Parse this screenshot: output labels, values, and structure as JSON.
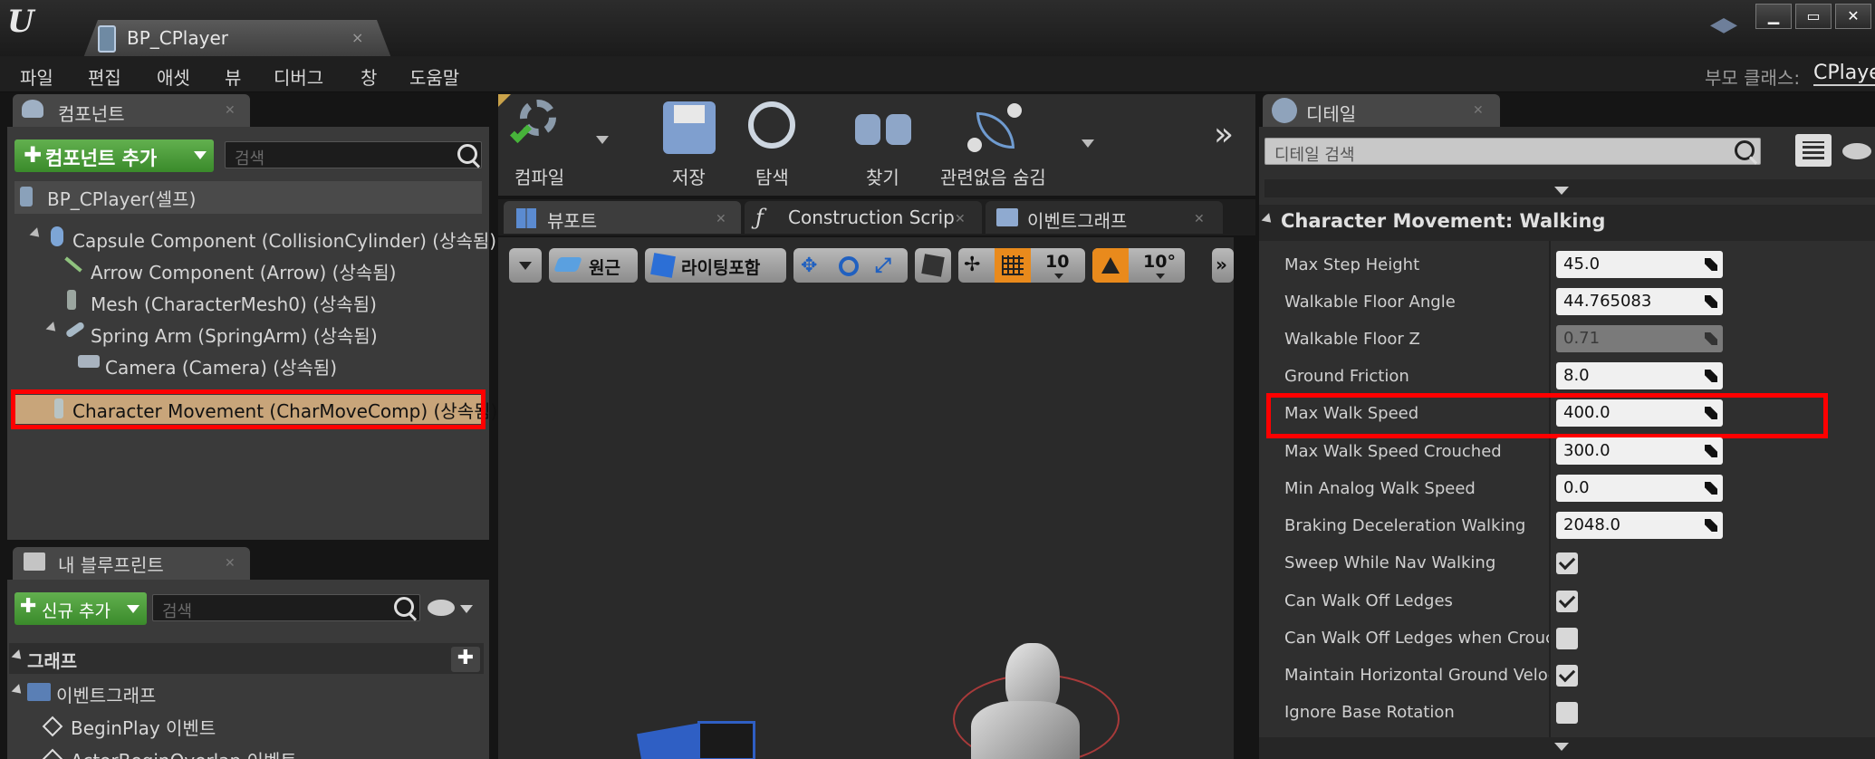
{
  "title_bar": {
    "tab_title": "BP_CPlayer",
    "tab_close": "×",
    "win_min": "▁",
    "win_max": "▭",
    "win_close": "✕"
  },
  "menu": {
    "items": [
      "파일",
      "편집",
      "애셋",
      "뷰",
      "디버그",
      "창",
      "도움말"
    ],
    "parent_class_label": "부모 클래스:",
    "parent_class_value": "CPlaye"
  },
  "components": {
    "tab_label": "컴포넌트",
    "add_button": "컴포넌트 추가",
    "search_placeholder": "검색",
    "self_item": "BP_CPlayer(셀프)",
    "items": [
      "Capsule Component (CollisionCylinder) (상속됨)",
      "Arrow Component (Arrow) (상속됨)",
      "Mesh (CharacterMesh0) (상속됨)",
      "Spring Arm (SpringArm) (상속됨)",
      "Camera (Camera) (상속됨)",
      "Character Movement (CharMoveComp) (상속됨)"
    ]
  },
  "my_blueprint": {
    "tab_label": "내 블루프린트",
    "add_button": "신규 추가",
    "search_placeholder": "검색",
    "graph_header": "그래프",
    "event_graph": "이벤트그래프",
    "events": [
      "BeginPlay 이벤트",
      "ActorBeginOverlap 이벤트"
    ]
  },
  "toolbar": {
    "compile": "컴파일",
    "save": "저장",
    "browse": "탐색",
    "find": "찾기",
    "hide_unrelated": "관련없음 숨김",
    "more": "»"
  },
  "editor_tabs": {
    "viewport": "뷰포트",
    "construction": "Construction Scrip",
    "event_graph": "이벤트그래프"
  },
  "viewport_toolbar": {
    "perspective": "원근",
    "lit": "라이팅포함",
    "grid_snap": "10",
    "rot_snap": "10°",
    "more": "»"
  },
  "details": {
    "tab_label": "디테일",
    "search_placeholder": "디테일 검색",
    "section_title": "Character Movement: Walking",
    "properties": [
      {
        "name": "Max Step Height",
        "value": "45.0"
      },
      {
        "name": "Walkable Floor Angle",
        "value": "44.765083"
      },
      {
        "name": "Walkable Floor Z",
        "value": "0.71"
      },
      {
        "name": "Ground Friction",
        "value": "8.0"
      },
      {
        "name": "Max Walk Speed",
        "value": "400.0"
      },
      {
        "name": "Max Walk Speed Crouched",
        "value": "300.0"
      },
      {
        "name": "Min Analog Walk Speed",
        "value": "0.0"
      },
      {
        "name": "Braking Deceleration Walking",
        "value": "2048.0"
      }
    ],
    "checkboxes": [
      {
        "name": "Sweep While Nav Walking",
        "checked": true
      },
      {
        "name": "Can Walk Off Ledges",
        "checked": true
      },
      {
        "name": "Can Walk Off Ledges when Crouch",
        "checked": false
      },
      {
        "name": "Maintain Horizontal Ground Veloci",
        "checked": true
      },
      {
        "name": "Ignore Base Rotation",
        "checked": false
      }
    ]
  },
  "colors": {
    "highlight": "#ff0000",
    "accent_green": "#4c9d3a",
    "selected_row": "#c8a57a"
  }
}
